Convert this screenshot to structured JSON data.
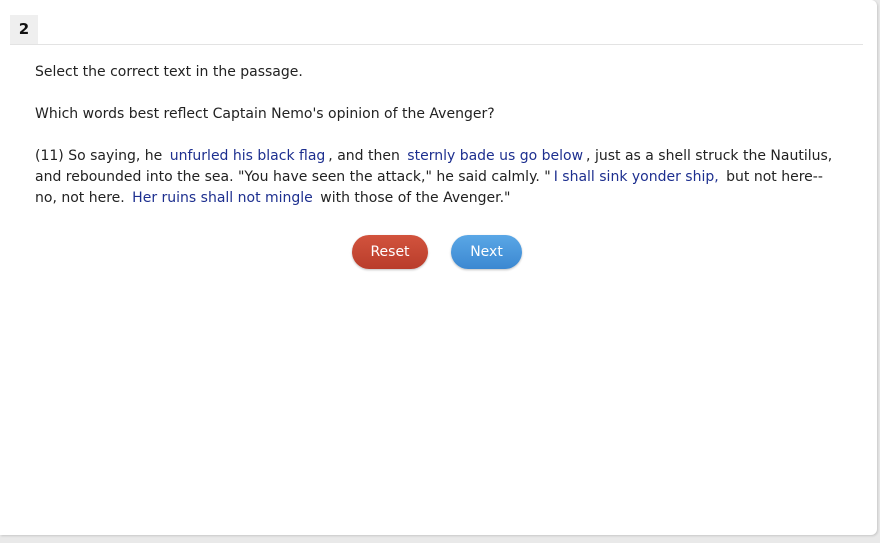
{
  "question_number": "2",
  "instruction": "Select the correct text in the passage.",
  "question": "Which words best reflect Captain Nemo's opinion of the Avenger?",
  "passage": {
    "seg1": "(11) So saying, he",
    "opt1": "unfurled his black flag",
    "seg2": ", and then",
    "opt2": "sternly bade us go below",
    "seg3": ", just as a shell struck the Nautilus, and rebounded into the sea. \"You have seen the attack,\" he said calmly. \"",
    "opt3": "I shall sink yonder ship,",
    "seg4": "but not here--no, not here.",
    "opt4": "Her ruins shall not mingle",
    "seg5": "with those of the Avenger.\""
  },
  "buttons": {
    "reset": "Reset",
    "next": "Next"
  },
  "colors": {
    "option_text": "#1d2f8f",
    "reset_button": "#c8493a",
    "next_button": "#4a98dc"
  }
}
